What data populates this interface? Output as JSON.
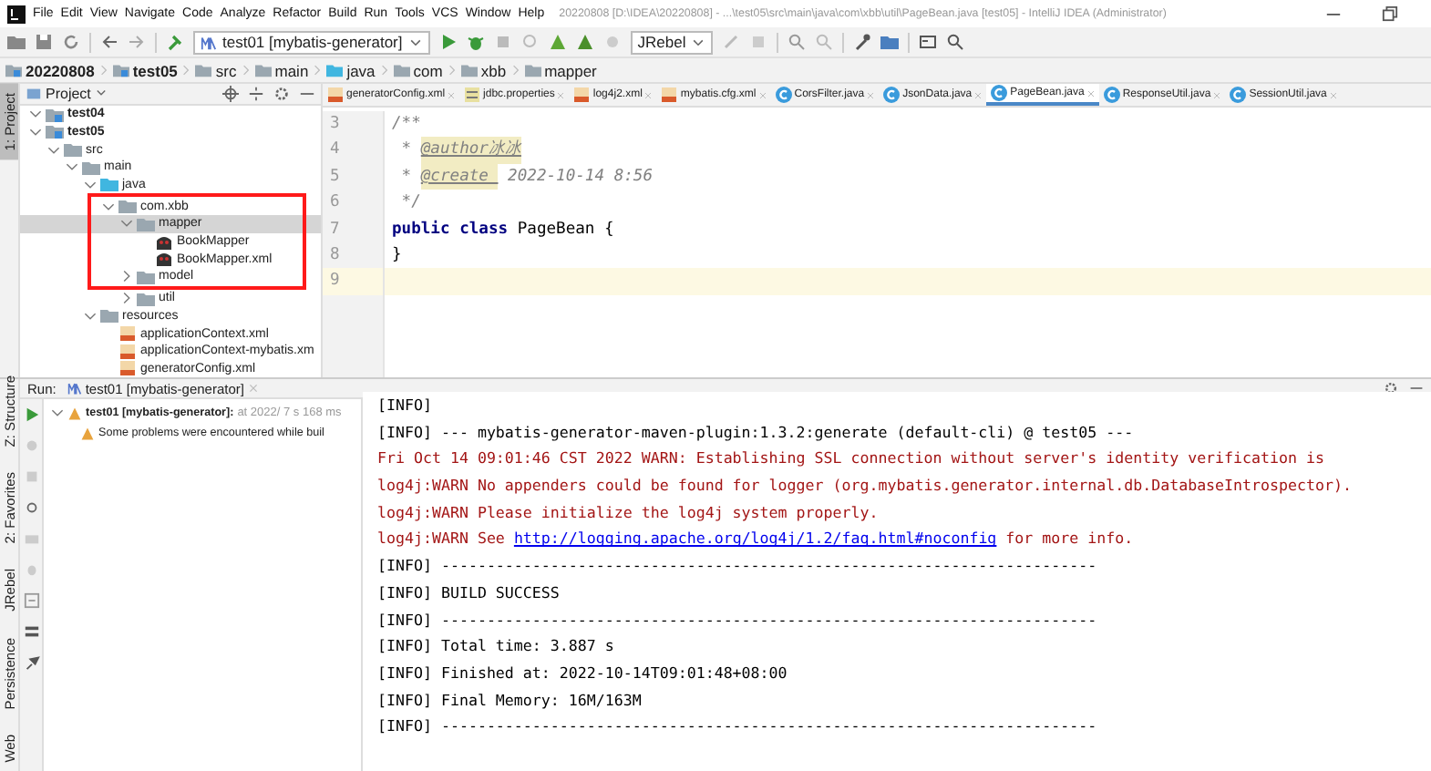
{
  "window": {
    "title": "20220808 [D:\\IDEA\\20220808] - ...\\test05\\src\\main\\java\\com\\xbb\\util\\PageBean.java [test05] - IntelliJ IDEA (Administrator)",
    "menu": [
      "File",
      "Edit",
      "View",
      "Navigate",
      "Code",
      "Analyze",
      "Refactor",
      "Build",
      "Run",
      "Tools",
      "VCS",
      "Window",
      "Help"
    ]
  },
  "toolbar": {
    "run_config": "test01 [mybatis-generator]",
    "jrebel": "JRebel"
  },
  "breadcrumb": [
    "20220808",
    "test05",
    "src",
    "main",
    "java",
    "com",
    "xbb",
    "mapper"
  ],
  "left_stripe_top": [
    {
      "label": "1: Project",
      "selected": true
    }
  ],
  "left_stripe_bottom": [
    {
      "label": "Z: Structure",
      "selected": false
    },
    {
      "label": "2: Favorites",
      "selected": false
    },
    {
      "label": "JRebel",
      "selected": false
    },
    {
      "label": "Persistence",
      "selected": false
    },
    {
      "label": "Web",
      "selected": false
    }
  ],
  "project": {
    "title": "Project",
    "tree": [
      {
        "label": "test04",
        "kind": "module",
        "expanded": true,
        "selected": false
      },
      {
        "label": "test05",
        "kind": "module",
        "expanded": true,
        "selected": false,
        "children": [
          {
            "label": "src",
            "kind": "folder",
            "expanded": true,
            "selected": false,
            "children": [
              {
                "label": "main",
                "kind": "folder",
                "expanded": true,
                "selected": false,
                "children": [
                  {
                    "label": "java",
                    "kind": "source",
                    "expanded": true,
                    "selected": false,
                    "children": [
                      {
                        "label": "com.xbb",
                        "kind": "folder",
                        "expanded": true,
                        "selected": false,
                        "children": [
                          {
                            "label": "mapper",
                            "kind": "folder",
                            "expanded": true,
                            "selected": true,
                            "children": [
                              {
                                "label": "BookMapper",
                                "kind": "mapper",
                                "selected": false
                              },
                              {
                                "label": "BookMapper.xml",
                                "kind": "mapper",
                                "selected": false
                              }
                            ]
                          },
                          {
                            "label": "model",
                            "kind": "folder",
                            "expanded": false,
                            "selected": false
                          },
                          {
                            "label": "util",
                            "kind": "folder",
                            "expanded": false,
                            "selected": false
                          }
                        ]
                      }
                    ]
                  },
                  {
                    "label": "resources",
                    "kind": "folder",
                    "expanded": true,
                    "selected": false,
                    "children": [
                      {
                        "label": "applicationContext.xml",
                        "kind": "xml",
                        "selected": false
                      },
                      {
                        "label": "applicationContext-mybatis.xm",
                        "kind": "xml",
                        "selected": false
                      },
                      {
                        "label": "generatorConfig.xml",
                        "kind": "xml",
                        "selected": false
                      }
                    ]
                  }
                ]
              }
            ]
          }
        ]
      }
    ]
  },
  "editor": {
    "tabs": [
      {
        "label": "generatorConfig.xml",
        "kind": "xml",
        "selected": false
      },
      {
        "label": "jdbc.properties",
        "kind": "properties",
        "selected": false
      },
      {
        "label": "log4j2.xml",
        "kind": "xml",
        "selected": false
      },
      {
        "label": "mybatis.cfg.xml",
        "kind": "xml",
        "selected": false
      },
      {
        "label": "CorsFilter.java",
        "kind": "java",
        "selected": false
      },
      {
        "label": "JsonData.java",
        "kind": "java",
        "selected": false
      },
      {
        "label": "PageBean.java",
        "kind": "java",
        "selected": true
      },
      {
        "label": "ResponseUtil.java",
        "kind": "java",
        "selected": false
      },
      {
        "label": "SessionUtil.java",
        "kind": "java",
        "selected": false
      }
    ],
    "lines": [
      {
        "number": "3",
        "current": false,
        "segments": [
          {
            "text": "/**",
            "kind": "comment"
          }
        ]
      },
      {
        "number": "4",
        "current": false,
        "segments": [
          {
            "text": " * ",
            "kind": "comment"
          },
          {
            "text": "@author冰冰",
            "kind": "tag"
          }
        ]
      },
      {
        "number": "5",
        "current": false,
        "segments": [
          {
            "text": " * ",
            "kind": "comment"
          },
          {
            "text": "@create ",
            "kind": "tag"
          },
          {
            "text": " 2022-10-14 8:56",
            "kind": "comment"
          }
        ]
      },
      {
        "number": "6",
        "current": false,
        "segments": [
          {
            "text": " */",
            "kind": "comment"
          }
        ]
      },
      {
        "number": "7",
        "current": false,
        "segments": [
          {
            "text": "public class",
            "kind": "keyword"
          },
          {
            "text": " PageBean {",
            "kind": "plain"
          }
        ]
      },
      {
        "number": "8",
        "current": false,
        "segments": [
          {
            "text": "}",
            "kind": "plain"
          }
        ]
      },
      {
        "number": "9",
        "current": true
      }
    ]
  },
  "run": {
    "label": "Run:",
    "tab": "test01 [mybatis-generator]",
    "tree": [
      {
        "title": "test01 [mybatis-generator]:",
        "detail": "at 2022/ 7 s 168 ms",
        "expanded": true,
        "children": [
          {
            "title": "Some problems were encountered while buil"
          }
        ]
      }
    ],
    "console": [
      [
        {
          "text": "[INFO]",
          "kind": "info"
        }
      ],
      [
        {
          "text": "[INFO] --- mybatis-generator-maven-plugin:1.3.2:generate (default-cli) @ test05 ---",
          "kind": "info"
        }
      ],
      [
        {
          "text": "Fri Oct 14 09:01:46 CST 2022 WARN: Establishing SSL connection without server's identity verification is",
          "kind": "warn"
        }
      ],
      [
        {
          "text": "log4j:WARN No appenders could be found for logger (org.mybatis.generator.internal.db.DatabaseIntrospector).",
          "kind": "warn"
        }
      ],
      [
        {
          "text": "log4j:WARN Please initialize the log4j system properly.",
          "kind": "warn"
        }
      ],
      [
        {
          "text": "log4j:WARN See ",
          "kind": "warn"
        },
        {
          "text": "http://logging.apache.org/log4j/1.2/faq.html#noconfig",
          "kind": "link"
        },
        {
          "text": " for more info.",
          "kind": "warn"
        }
      ],
      [
        {
          "text": "[INFO] ------------------------------------------------------------------------",
          "kind": "info"
        }
      ],
      [
        {
          "text": "[INFO] BUILD SUCCESS",
          "kind": "info"
        }
      ],
      [
        {
          "text": "[INFO] ------------------------------------------------------------------------",
          "kind": "info"
        }
      ],
      [
        {
          "text": "[INFO] Total time: 3.887 s",
          "kind": "info"
        }
      ],
      [
        {
          "text": "[INFO] Finished at: 2022-10-14T09:01:48+08:00",
          "kind": "info"
        }
      ],
      [
        {
          "text": "[INFO] Final Memory: 16M/163M",
          "kind": "info"
        }
      ],
      [
        {
          "text": "[INFO] ------------------------------------------------------------------------",
          "kind": "info"
        }
      ]
    ]
  }
}
